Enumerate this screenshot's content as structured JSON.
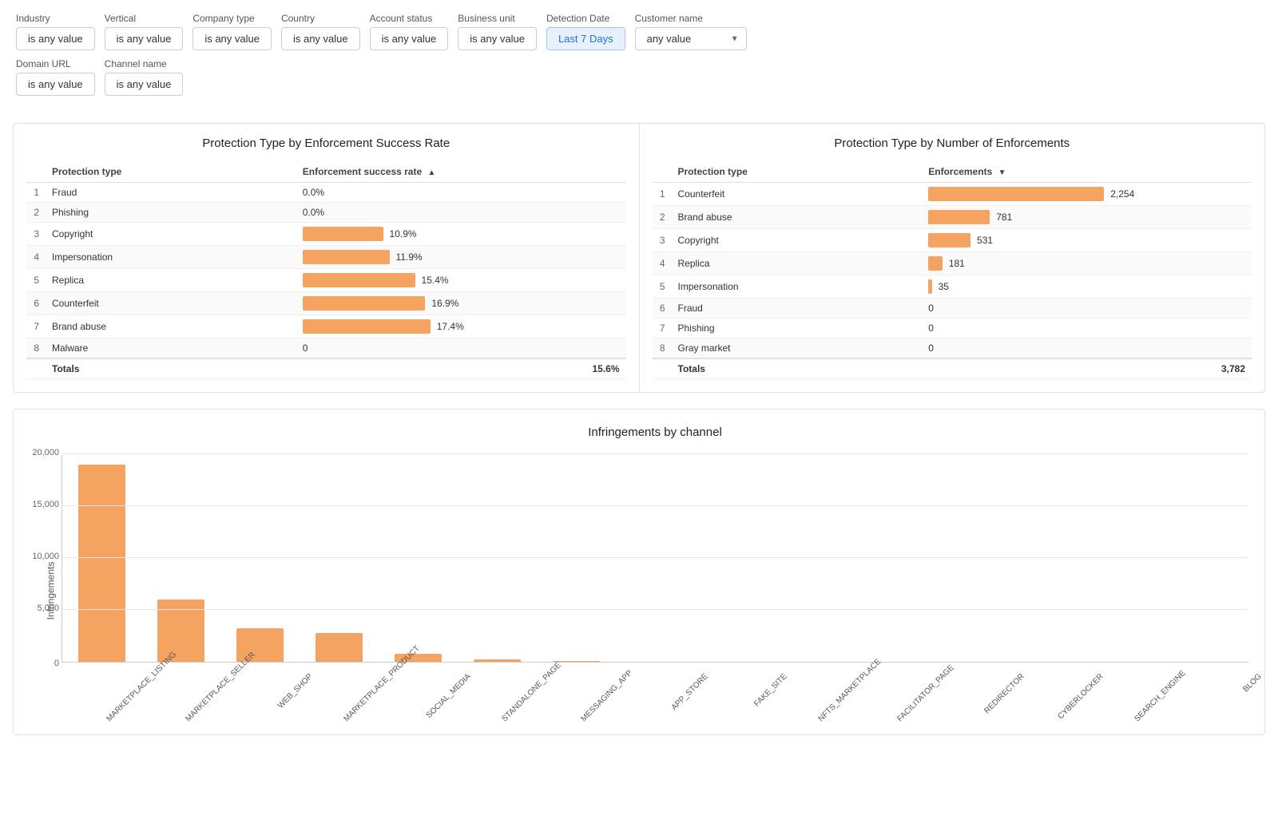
{
  "filters": {
    "row1": [
      {
        "label": "Industry",
        "value": "is any value",
        "type": "btn"
      },
      {
        "label": "Vertical",
        "value": "is any value",
        "type": "btn"
      },
      {
        "label": "Company type",
        "value": "is any value",
        "type": "btn"
      },
      {
        "label": "Country",
        "value": "is any value",
        "type": "btn"
      },
      {
        "label": "Account status",
        "value": "is any value",
        "type": "btn"
      },
      {
        "label": "Business unit",
        "value": "is any value",
        "type": "btn"
      },
      {
        "label": "Detection Date",
        "value": "Last 7 Days",
        "type": "btn-blue"
      },
      {
        "label": "Customer name",
        "value": "any value",
        "type": "select"
      }
    ],
    "row2": [
      {
        "label": "Domain URL",
        "value": "is any value",
        "type": "btn"
      },
      {
        "label": "Channel name",
        "value": "is any value",
        "type": "btn"
      }
    ]
  },
  "chart1": {
    "title": "Protection Type by Enforcement Success Rate",
    "col1": "Protection type",
    "col2": "Enforcement success rate",
    "rows": [
      {
        "num": 1,
        "name": "Fraud",
        "value": "0.0%",
        "barPct": 0
      },
      {
        "num": 2,
        "name": "Phishing",
        "value": "0.0%",
        "barPct": 0
      },
      {
        "num": 3,
        "name": "Copyright",
        "value": "10.9%",
        "barPct": 63
      },
      {
        "num": 4,
        "name": "Impersonation",
        "value": "11.9%",
        "barPct": 68
      },
      {
        "num": 5,
        "name": "Replica",
        "value": "15.4%",
        "barPct": 88
      },
      {
        "num": 6,
        "name": "Counterfeit",
        "value": "16.9%",
        "barPct": 96
      },
      {
        "num": 7,
        "name": "Brand abuse",
        "value": "17.4%",
        "barPct": 100
      },
      {
        "num": 8,
        "name": "Malware",
        "value": "0",
        "barPct": 0,
        "partial": true
      }
    ],
    "totals": "15.6%"
  },
  "chart2": {
    "title": "Protection Type by Number of Enforcements",
    "col1": "Protection type",
    "col2": "Enforcements",
    "rows": [
      {
        "num": 1,
        "name": "Counterfeit",
        "value": "2,254",
        "barPct": 100
      },
      {
        "num": 2,
        "name": "Brand abuse",
        "value": "781",
        "barPct": 35
      },
      {
        "num": 3,
        "name": "Copyright",
        "value": "531",
        "barPct": 24
      },
      {
        "num": 4,
        "name": "Replica",
        "value": "181",
        "barPct": 8
      },
      {
        "num": 5,
        "name": "Impersonation",
        "value": "35",
        "barPct": 2
      },
      {
        "num": 6,
        "name": "Fraud",
        "value": "0",
        "barPct": 0
      },
      {
        "num": 7,
        "name": "Phishing",
        "value": "0",
        "barPct": 0
      },
      {
        "num": 8,
        "name": "Gray market",
        "value": "0",
        "barPct": 0,
        "partial": true
      }
    ],
    "totals": "3,782"
  },
  "chart3": {
    "title": "Infringements by channel",
    "yLabel": "Infringements",
    "gridLines": [
      "20,000",
      "15,000",
      "10,000",
      "5,000",
      "0"
    ],
    "bars": [
      {
        "label": "MARKETPLACE_LISTING",
        "heightPct": 95
      },
      {
        "label": "MARKETPLACE_SELLER",
        "heightPct": 30
      },
      {
        "label": "WEB_SHOP",
        "heightPct": 16
      },
      {
        "label": "MARKETPLACE_PRODUCT",
        "heightPct": 14
      },
      {
        "label": "SOCIAL_MEDIA",
        "heightPct": 4
      },
      {
        "label": "STANDALONE_PAGE",
        "heightPct": 1
      },
      {
        "label": "MESSAGING_APP",
        "heightPct": 0.2
      },
      {
        "label": "APP_STORE",
        "heightPct": 0
      },
      {
        "label": "FAKE_SITE",
        "heightPct": 0
      },
      {
        "label": "NFTS_MARKETPLACE",
        "heightPct": 0
      },
      {
        "label": "FACILITATOR_PAGE",
        "heightPct": 0
      },
      {
        "label": "REDIRECTOR",
        "heightPct": 0
      },
      {
        "label": "CYBERLOCKER",
        "heightPct": 0
      },
      {
        "label": "SEARCH_ENGINE",
        "heightPct": 0
      },
      {
        "label": "BLOG",
        "heightPct": 0
      }
    ]
  }
}
